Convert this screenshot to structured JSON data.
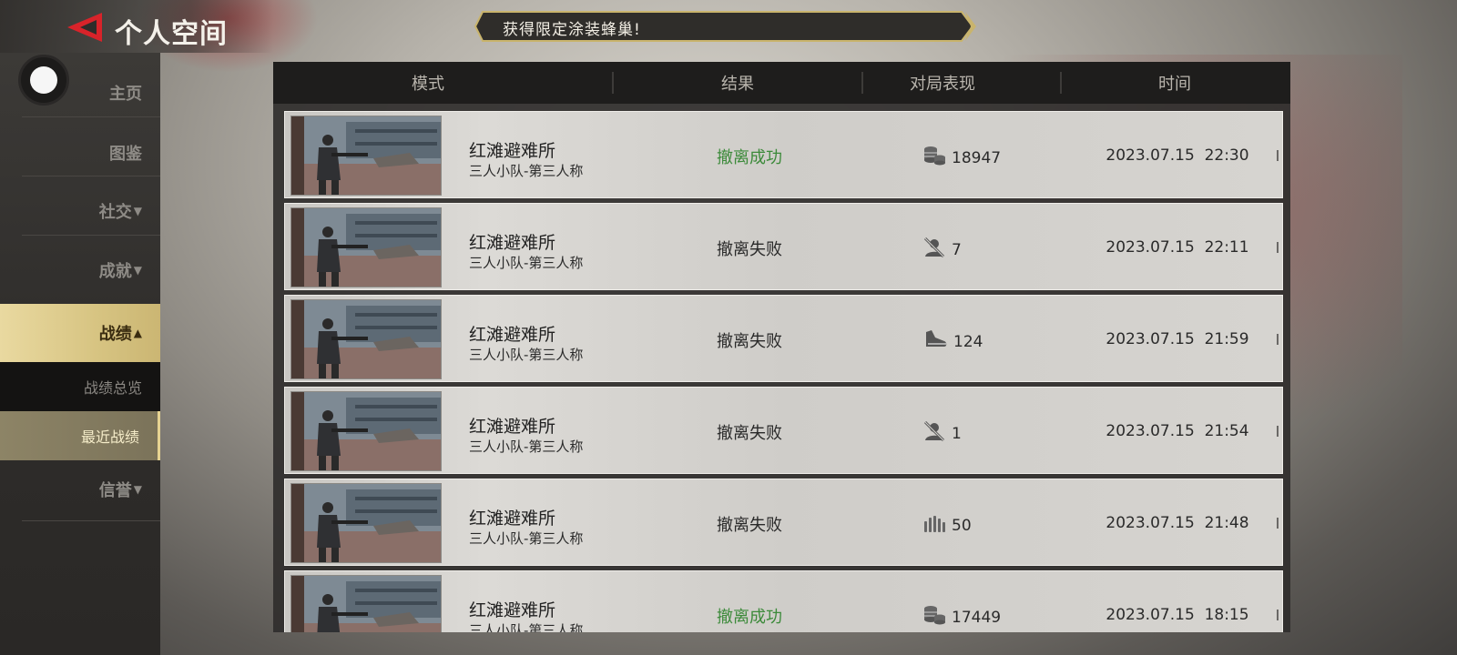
{
  "header": {
    "title": "个人空间",
    "banner_text": "获得限定涂装蜂巢!"
  },
  "sidebar": {
    "items": [
      {
        "label": "主页",
        "arrow": ""
      },
      {
        "label": "图鉴",
        "arrow": ""
      },
      {
        "label": "社交",
        "arrow": "▼"
      },
      {
        "label": "成就",
        "arrow": "▼"
      },
      {
        "label": "战绩",
        "arrow": "▲"
      },
      {
        "label": "信誉",
        "arrow": "▼"
      }
    ],
    "sub_items": [
      {
        "label": "战绩总览"
      },
      {
        "label": "最近战绩"
      }
    ]
  },
  "table": {
    "columns": [
      "模式",
      "结果",
      "对局表现",
      "时间"
    ],
    "rows": [
      {
        "map": "红滩避难所",
        "mode": "三人小队-第三人称",
        "result": "撤离成功",
        "win": true,
        "perf_icon": "coins-icon",
        "perf": "18947",
        "time": "2023.07.15  22:30"
      },
      {
        "map": "红滩避难所",
        "mode": "三人小队-第三人称",
        "result": "撤离失败",
        "win": false,
        "perf_icon": "no-kill-icon",
        "perf": "7",
        "time": "2023.07.15  22:11"
      },
      {
        "map": "红滩避难所",
        "mode": "三人小队-第三人称",
        "result": "撤离失败",
        "win": false,
        "perf_icon": "boot-icon",
        "perf": "124",
        "time": "2023.07.15  21:59"
      },
      {
        "map": "红滩避难所",
        "mode": "三人小队-第三人称",
        "result": "撤离失败",
        "win": false,
        "perf_icon": "no-kill-icon",
        "perf": "1",
        "time": "2023.07.15  21:54"
      },
      {
        "map": "红滩避难所",
        "mode": "三人小队-第三人称",
        "result": "撤离失败",
        "win": false,
        "perf_icon": "ammo-icon",
        "perf": "50",
        "time": "2023.07.15  21:48"
      },
      {
        "map": "红滩避难所",
        "mode": "三人小队-第三人称",
        "result": "撤离成功",
        "win": true,
        "perf_icon": "coins-icon",
        "perf": "17449",
        "time": "2023.07.15  18:15"
      }
    ]
  },
  "colors": {
    "win": "#3c8a3a",
    "accent_gold": "#d7c482",
    "back_red": "#d8232a"
  }
}
